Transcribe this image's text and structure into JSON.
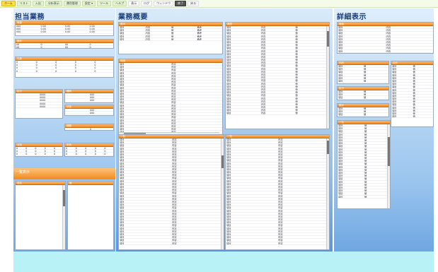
{
  "menu": [
    {
      "label": "ホーム",
      "style": "active"
    },
    {
      "label": "リスト",
      "style": ""
    },
    {
      "label": "入出",
      "style": ""
    },
    {
      "label": "分析表示",
      "style": ""
    },
    {
      "label": "運用管理",
      "style": ""
    },
    {
      "label": "設定 ▾",
      "style": ""
    },
    {
      "label": "ツール",
      "style": ""
    },
    {
      "label": "ヘルプ",
      "style": ""
    },
    {
      "label": "表示",
      "style": "plain"
    },
    {
      "label": "ログ",
      "style": "plain"
    },
    {
      "label": "ウィンドウ",
      "style": "plain"
    },
    {
      "label": "終了",
      "style": "dark"
    },
    {
      "label": "戻る",
      "style": "plain"
    }
  ],
  "columns": {
    "left_title": "担当業務",
    "mid_title": "業務概要",
    "right_title": "詳細表示"
  },
  "left": {
    "p1_head": "概要",
    "p1_rows": [
      [
        "000",
        "0.00",
        "0.00",
        "0.00"
      ],
      [
        "000",
        "0.00",
        "0.00",
        "0.00"
      ],
      [
        "000",
        "0.00",
        "0.00",
        "0.00"
      ]
    ],
    "p2_head": "集計",
    "p2_rows": [
      [
        "00",
        "0",
        "00",
        "0"
      ],
      [
        "00",
        "0",
        "00",
        "0"
      ]
    ],
    "p3_head": "件数",
    "p3_rows": [
      [
        "0",
        "0",
        "0",
        "0",
        "0"
      ],
      [
        "0",
        "0",
        "0",
        "0",
        "0"
      ],
      [
        "0",
        "0",
        "0",
        "0",
        "0"
      ],
      [
        "0",
        "0",
        "0",
        "0",
        "0"
      ]
    ],
    "p4_head": "区分",
    "p4_rows": [
      [
        "",
        "0000"
      ],
      [
        "",
        "0000"
      ],
      [
        "",
        "0000"
      ],
      [
        "",
        "0000"
      ],
      [
        "",
        "0000"
      ]
    ],
    "p5_head": "種別",
    "p5_rows": [
      [
        "",
        "000"
      ],
      [
        "",
        "000"
      ],
      [
        "",
        "000"
      ]
    ],
    "p6_head": "状態",
    "p6_rows": [
      [
        "",
        "000"
      ],
      [
        "",
        "000"
      ]
    ],
    "p7_head": "期間",
    "p7_rows": [
      [
        "",
        "0"
      ]
    ],
    "p8_head": "月別",
    "p8_rows": [
      [
        "0",
        "0",
        "0",
        "0",
        "0"
      ],
      [
        "0",
        "0",
        "0",
        "0",
        "0"
      ],
      [
        "0",
        "0",
        "0",
        "0",
        "0"
      ]
    ],
    "p9_head": "年別",
    "p9_rows": [
      [
        "0",
        "0",
        "0",
        "0",
        "0"
      ],
      [
        "0",
        "0",
        "0",
        "0",
        "0"
      ],
      [
        "0",
        "0",
        "0",
        "0",
        "0"
      ]
    ],
    "band_text": "一覧表示",
    "p10_head": "項目",
    "p11_head": "値"
  },
  "mid": {
    "a_head": "基本",
    "a_rows": [
      [
        "項目",
        "内容",
        "値",
        "備考"
      ],
      [
        "項目",
        "内容",
        "値",
        "備考"
      ],
      [
        "項目",
        "内容",
        "値",
        "備考"
      ],
      [
        "項目",
        "内容",
        "値",
        "備考"
      ],
      [
        "項目",
        "内容",
        "値",
        "備考"
      ]
    ],
    "b_head": "明細",
    "b_rows": [
      [
        "項目",
        "内容"
      ],
      [
        "項目",
        "内容"
      ],
      [
        "項目",
        "内容"
      ],
      [
        "項目",
        "内容"
      ],
      [
        "項目",
        "内容"
      ],
      [
        "項目",
        "内容"
      ],
      [
        "項目",
        "内容"
      ],
      [
        "項目",
        "内容"
      ],
      [
        "項目",
        "内容"
      ],
      [
        "項目",
        "内容"
      ],
      [
        "項目",
        "内容"
      ],
      [
        "項目",
        "内容"
      ],
      [
        "項目",
        "内容"
      ],
      [
        "項目",
        "内容"
      ],
      [
        "項目",
        "内容"
      ],
      [
        "項目",
        "内容"
      ],
      [
        "項目",
        "内容"
      ],
      [
        "項目",
        "内容"
      ],
      [
        "項目",
        "内容"
      ],
      [
        "項目",
        "内容"
      ],
      [
        "項目",
        "内容"
      ],
      [
        "項目",
        "内容"
      ],
      [
        "項目",
        "内容"
      ],
      [
        "項目",
        "内容"
      ],
      [
        "項目",
        "内容"
      ],
      [
        "項目",
        "内容"
      ]
    ],
    "c_head": "履歴",
    "c_rows": [
      [
        "項目",
        "内容",
        "値"
      ],
      [
        "項目",
        "内容",
        "値"
      ],
      [
        "項目",
        "内容",
        "値"
      ],
      [
        "項目",
        "内容",
        "値"
      ],
      [
        "項目",
        "内容",
        "値"
      ],
      [
        "項目",
        "内容",
        "値"
      ],
      [
        "項目",
        "内容",
        "値"
      ],
      [
        "項目",
        "内容",
        "値"
      ],
      [
        "項目",
        "内容",
        "値"
      ],
      [
        "項目",
        "内容",
        "値"
      ],
      [
        "項目",
        "内容",
        "値"
      ],
      [
        "項目",
        "内容",
        "値"
      ],
      [
        "項目",
        "内容",
        "値"
      ],
      [
        "項目",
        "内容",
        "値"
      ],
      [
        "項目",
        "内容",
        "値"
      ],
      [
        "項目",
        "内容",
        "値"
      ],
      [
        "項目",
        "内容",
        "値"
      ],
      [
        "項目",
        "内容",
        "値"
      ],
      [
        "項目",
        "内容",
        "値"
      ],
      [
        "項目",
        "内容",
        "値"
      ],
      [
        "項目",
        "内容",
        "値"
      ],
      [
        "項目",
        "内容",
        "値"
      ],
      [
        "項目",
        "内容",
        "値"
      ],
      [
        "項目",
        "内容",
        "値"
      ],
      [
        "項目",
        "内容",
        "値"
      ],
      [
        "項目",
        "内容",
        "値"
      ],
      [
        "項目",
        "内容",
        "値"
      ],
      [
        "項目",
        "内容",
        "値"
      ],
      [
        "項目",
        "内容",
        "値"
      ],
      [
        "項目",
        "内容",
        "値"
      ]
    ],
    "d_head": "一覧",
    "d_rows": [
      [
        "項目",
        "内容"
      ],
      [
        "項目",
        "内容"
      ],
      [
        "項目",
        "内容"
      ],
      [
        "項目",
        "内容"
      ],
      [
        "項目",
        "内容"
      ],
      [
        "項目",
        "内容"
      ],
      [
        "項目",
        "内容"
      ],
      [
        "項目",
        "内容"
      ],
      [
        "項目",
        "内容"
      ],
      [
        "項目",
        "内容"
      ],
      [
        "項目",
        "内容"
      ],
      [
        "項目",
        "内容"
      ],
      [
        "項目",
        "内容"
      ],
      [
        "項目",
        "内容"
      ],
      [
        "項目",
        "内容"
      ],
      [
        "項目",
        "内容"
      ],
      [
        "項目",
        "内容"
      ],
      [
        "項目",
        "内容"
      ],
      [
        "項目",
        "内容"
      ],
      [
        "項目",
        "内容"
      ],
      [
        "項目",
        "内容"
      ],
      [
        "項目",
        "内容"
      ],
      [
        "項目",
        "内容"
      ],
      [
        "項目",
        "内容"
      ],
      [
        "項目",
        "内容"
      ],
      [
        "項目",
        "内容"
      ],
      [
        "項目",
        "内容"
      ],
      [
        "項目",
        "内容"
      ],
      [
        "項目",
        "内容"
      ],
      [
        "項目",
        "内容"
      ],
      [
        "項目",
        "内容"
      ],
      [
        "項目",
        "内容"
      ],
      [
        "項目",
        "内容"
      ],
      [
        "項目",
        "内容"
      ],
      [
        "項目",
        "内容"
      ],
      [
        "項目",
        "内容"
      ]
    ],
    "e_head": "一覧",
    "e_rows": [
      [
        "項目",
        "内容"
      ],
      [
        "項目",
        "内容"
      ],
      [
        "項目",
        "内容"
      ],
      [
        "項目",
        "内容"
      ],
      [
        "項目",
        "内容"
      ],
      [
        "項目",
        "内容"
      ],
      [
        "項目",
        "内容"
      ],
      [
        "項目",
        "内容"
      ],
      [
        "項目",
        "内容"
      ],
      [
        "項目",
        "内容"
      ],
      [
        "項目",
        "内容"
      ],
      [
        "項目",
        "内容"
      ],
      [
        "項目",
        "内容"
      ],
      [
        "項目",
        "内容"
      ],
      [
        "項目",
        "内容"
      ],
      [
        "項目",
        "内容"
      ],
      [
        "項目",
        "内容"
      ],
      [
        "項目",
        "内容"
      ],
      [
        "項目",
        "内容"
      ],
      [
        "項目",
        "内容"
      ],
      [
        "項目",
        "内容"
      ],
      [
        "項目",
        "内容"
      ],
      [
        "項目",
        "内容"
      ],
      [
        "項目",
        "内容"
      ],
      [
        "項目",
        "内容"
      ],
      [
        "項目",
        "内容"
      ],
      [
        "項目",
        "内容"
      ],
      [
        "項目",
        "内容"
      ],
      [
        "項目",
        "内容"
      ],
      [
        "項目",
        "内容"
      ],
      [
        "項目",
        "内容"
      ],
      [
        "項目",
        "内容"
      ],
      [
        "項目",
        "内容"
      ],
      [
        "項目",
        "内容"
      ],
      [
        "項目",
        "内容"
      ],
      [
        "項目",
        "内容"
      ]
    ]
  },
  "right": {
    "r1_head": "情報",
    "r1_rows": [
      [
        "項目",
        "内容"
      ],
      [
        "項目",
        "内容"
      ],
      [
        "項目",
        "内容"
      ],
      [
        "項目",
        "内容"
      ],
      [
        "項目",
        "内容"
      ],
      [
        "項目",
        "内容"
      ],
      [
        "項目",
        "内容"
      ],
      [
        "項目",
        "内容"
      ],
      [
        "項目",
        "内容"
      ]
    ],
    "r2_head": "内訳",
    "r2_rows": [
      [
        "項目",
        "値"
      ],
      [
        "項目",
        "値"
      ],
      [
        "項目",
        "値"
      ],
      [
        "項目",
        "値"
      ],
      [
        "項目",
        "値"
      ],
      [
        "項目",
        "値"
      ]
    ],
    "r3_head": "合計",
    "r3_rows": [
      [
        "項目",
        "値"
      ],
      [
        "項目",
        "値"
      ],
      [
        "項目",
        "値"
      ],
      [
        "項目",
        "値"
      ],
      [
        "項目",
        "値"
      ],
      [
        "項目",
        "値"
      ],
      [
        "項目",
        "値"
      ],
      [
        "項目",
        "値"
      ],
      [
        "項目",
        "値"
      ],
      [
        "項目",
        "値"
      ],
      [
        "項目",
        "値"
      ],
      [
        "項目",
        "値"
      ],
      [
        "項目",
        "値"
      ],
      [
        "項目",
        "値"
      ],
      [
        "項目",
        "値"
      ],
      [
        "項目",
        "値"
      ],
      [
        "項目",
        "値"
      ],
      [
        "項目",
        "値"
      ]
    ],
    "r4_head": "区分",
    "r4_rows": [
      [
        "項目",
        "値"
      ],
      [
        "項目",
        "値"
      ],
      [
        "項目",
        "値"
      ]
    ],
    "r5_head": "集計",
    "r5_rows": [
      [
        "項目",
        "値"
      ],
      [
        "項目",
        "値"
      ],
      [
        "項目",
        "値"
      ]
    ],
    "r6_head": "一覧",
    "r6_rows": [
      [
        "項目",
        "値"
      ],
      [
        "項目",
        "値"
      ],
      [
        "項目",
        "値"
      ],
      [
        "項目",
        "値"
      ],
      [
        "項目",
        "値"
      ],
      [
        "項目",
        "値"
      ],
      [
        "項目",
        "値"
      ],
      [
        "項目",
        "値"
      ],
      [
        "項目",
        "値"
      ],
      [
        "項目",
        "値"
      ],
      [
        "項目",
        "値"
      ],
      [
        "項目",
        "値"
      ],
      [
        "項目",
        "値"
      ],
      [
        "項目",
        "値"
      ],
      [
        "項目",
        "値"
      ],
      [
        "項目",
        "値"
      ],
      [
        "項目",
        "値"
      ],
      [
        "項目",
        "値"
      ],
      [
        "項目",
        "値"
      ],
      [
        "項目",
        "値"
      ],
      [
        "項目",
        "値"
      ],
      [
        "項目",
        "値"
      ],
      [
        "項目",
        "値"
      ],
      [
        "項目",
        "値"
      ],
      [
        "項目",
        "値"
      ]
    ]
  }
}
